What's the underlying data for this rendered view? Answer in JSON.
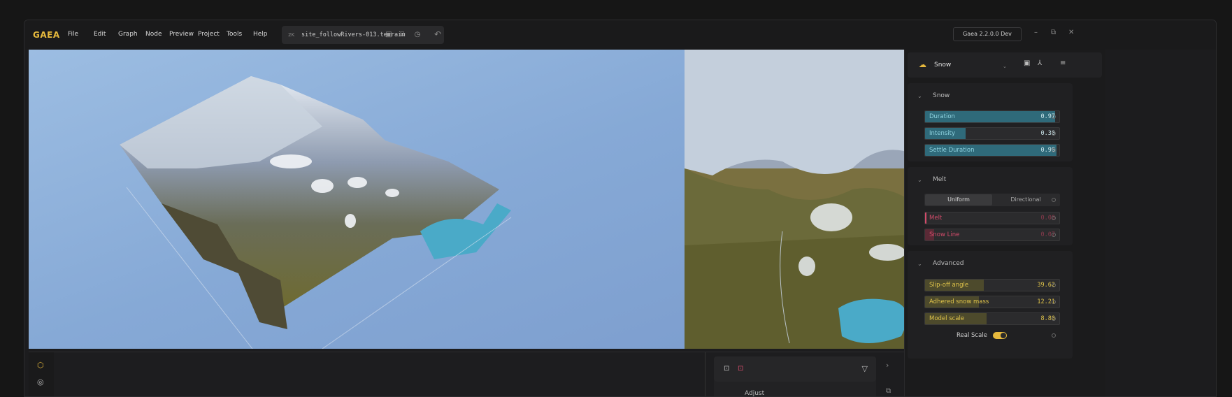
{
  "app": {
    "logo": "GAEA",
    "version": "Gaea 2.2.0.0 Dev"
  },
  "menu": [
    "File",
    "Edit",
    "Graph",
    "Node",
    "Preview",
    "Project",
    "Tools",
    "Help"
  ],
  "file": {
    "resolution": "2K",
    "name": "site_followRivers-013.terrain"
  },
  "viewport": {
    "toolbar_res": "2K"
  },
  "node_panel": {
    "title": "Snow",
    "sections": {
      "snow": {
        "title": "Snow",
        "params": [
          {
            "label": "Duration",
            "value": "0.97",
            "level": 0.97
          },
          {
            "label": "Intensity",
            "value": "0.30",
            "level": 0.3
          },
          {
            "label": "Settle Duration",
            "value": "0.98",
            "level": 0.98
          }
        ]
      },
      "melt": {
        "title": "Melt",
        "mode_options": [
          "Uniform",
          "Directional"
        ],
        "mode_selected": "Uniform",
        "params": [
          {
            "label": "Melt",
            "value": "0.00",
            "level": 0.0
          },
          {
            "label": "Snow Line",
            "value": "0.07",
            "level": 0.07
          }
        ]
      },
      "advanced": {
        "title": "Advanced",
        "params": [
          {
            "label": "Slip-off angle",
            "value": "39.62",
            "level": 0.44
          },
          {
            "label": "Adhered snow mass",
            "value": "12.21",
            "level": 0.4
          },
          {
            "label": "Model scale",
            "value": "8.80",
            "level": 0.46
          }
        ],
        "toggle_label": "Real Scale",
        "toggle_on": true
      }
    }
  },
  "bottom": {
    "list_item": "Adjust"
  },
  "colors": {
    "accent": "#e6b93d",
    "snow_fill": "#2f6a7a",
    "snow_text": "#5ec6d6",
    "melt_text": "#d24b6a",
    "adv_fill": "#4d4a2c",
    "adv_text": "#e0c44a"
  }
}
